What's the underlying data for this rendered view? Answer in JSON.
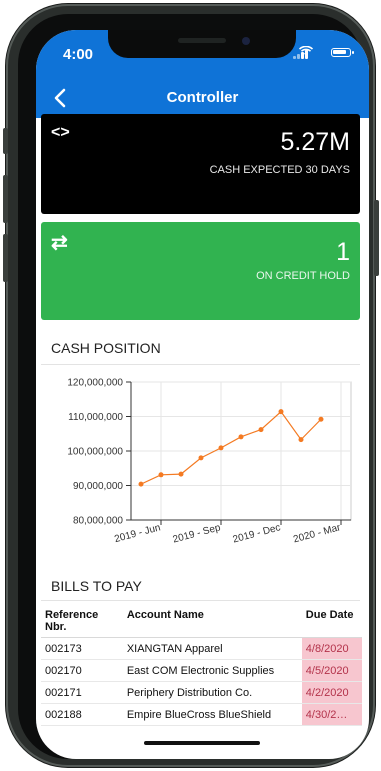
{
  "status_bar": {
    "time": "4:00",
    "icons": [
      "signal-icon",
      "wifi-icon",
      "battery-icon"
    ]
  },
  "nav": {
    "title": "Controller",
    "back_icon": "chevron-left-icon"
  },
  "kpis": [
    {
      "icon": "code-icon",
      "value": "5.27M",
      "label": "CASH EXPECTED 30 DAYS",
      "color": "#000000"
    },
    {
      "icon": "swap-arrows-icon",
      "value": "1",
      "label": "ON CREDIT HOLD",
      "color": "#31b350"
    }
  ],
  "cash_position": {
    "title": "CASH POSITION"
  },
  "chart_data": {
    "type": "line",
    "title": "",
    "xlabel": "",
    "ylabel": "",
    "x": [
      "2019-05",
      "2019-06",
      "2019-07",
      "2019-08",
      "2019-09",
      "2019-10",
      "2019-11",
      "2019-12",
      "2020-01",
      "2020-02",
      "2020-03"
    ],
    "x_tick_labels": [
      "2019 - Jun",
      "2019 - Sep",
      "2019 - Dec",
      "2020 - Mar"
    ],
    "x_tick_positions": [
      "2019-06",
      "2019-09",
      "2019-12",
      "2020-03"
    ],
    "series": [
      {
        "color": "#f47a22",
        "values": [
          90400000,
          93100000,
          93300000,
          98000000,
          100900000,
          104100000,
          106200000,
          111400000,
          103300000,
          109200000
        ]
      }
    ],
    "y_ticks": [
      "80,000,000",
      "90,000,000",
      "100,000,000",
      "110,000,000",
      "120,000,000"
    ],
    "ylim": [
      80000000,
      120000000
    ],
    "grid": true,
    "legend": "none"
  },
  "bills": {
    "title": "BILLS TO PAY",
    "columns": {
      "ref": "Reference Nbr.",
      "account": "Account Name",
      "due": "Due Date"
    },
    "rows": [
      {
        "ref": "002173",
        "account": "XIANGTAN Apparel",
        "due": "4/8/2020"
      },
      {
        "ref": "002170",
        "account": "East COM Electronic Supplies",
        "due": "4/5/2020"
      },
      {
        "ref": "002171",
        "account": "Periphery Distribution Co.",
        "due": "4/2/2020"
      },
      {
        "ref": "002188",
        "account": "Empire BlueCross BlueShield",
        "due": "4/30/2…"
      }
    ],
    "overdue_color": "#f7c6cf"
  }
}
